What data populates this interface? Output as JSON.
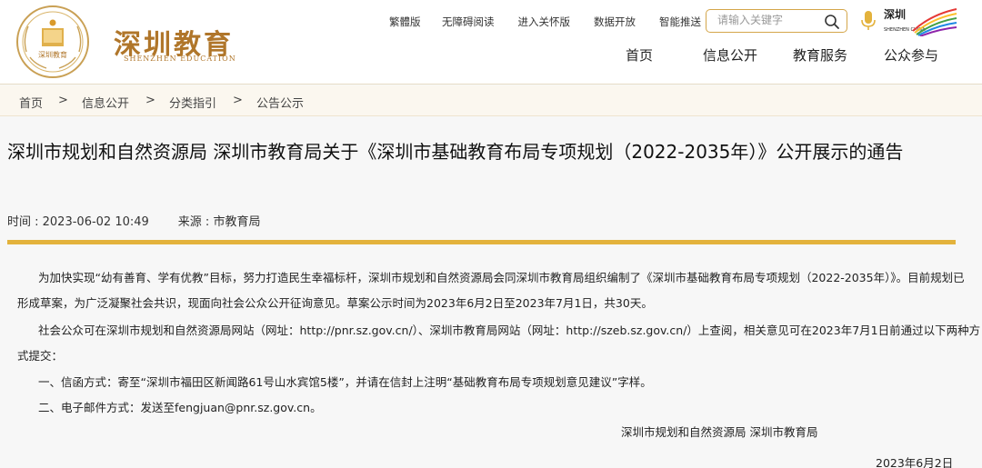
{
  "header": {
    "logo_title": "深圳教育",
    "logo_sub": "SHENZHEN EDUCATION",
    "emblem_text": "深圳教育",
    "top_links": [
      "繁體版",
      "无障碍阅读",
      "进入关怀版",
      "数据开放",
      "智能推送"
    ],
    "search": {
      "placeholder": "请输入关键字"
    },
    "sz_logo_text": "深圳",
    "sz_logo_sub": "SHENZHEN CHINA",
    "nav": [
      "首页",
      "信息公开",
      "教育服务",
      "公众参与"
    ]
  },
  "breadcrumb": [
    "首页",
    ">",
    "信息公开",
    ">",
    "分类指引",
    ">",
    "公告公示"
  ],
  "article": {
    "title": "深圳市规划和自然资源局 深圳市教育局关于《深圳市基础教育布局专项规划（2022-2035年）》公开展示的通告",
    "time": "时间 : 2023-06-02 10:49",
    "source": "来源 : 市教育局",
    "p1_l1": "为加快实现“幼有善育、学有优教”目标，努力打造民生幸福标杆，深圳市规划和自然资源局会同深圳市教育局组织编制了《深圳市基础教育布局专项规划（2022-2035年）》。目前规划已",
    "p1_l2": "形成草案，为广泛凝聚社会共识，现面向社会公众公开征询意见。草案公示时间为2023年6月2日至2023年7月1日，共30天。",
    "p2_l1": "社会公众可在深圳市规划和自然资源局网站（网址：http://pnr.sz.gov.cn/）、深圳市教育局网站（网址：http://szeb.sz.gov.cn/）上查阅，相关意见可在2023年7月1日前通过以下两种方",
    "p2_l2": "式提交：",
    "p3": "一、信函方式：寄至“深圳市福田区新闻路61号山水宾馆5楼”，并请在信封上注明“基础教育布局专项规划意见建议”字样。",
    "p4": "二、电子邮件方式：发送至fengjuan@pnr.sz.gov.cn。",
    "signature": "深圳市规划和自然资源局 深圳市教育局",
    "date": "2023年6月2日"
  },
  "colors": {
    "gold": "#e3b23c",
    "brand_brown": "#b0762a"
  }
}
